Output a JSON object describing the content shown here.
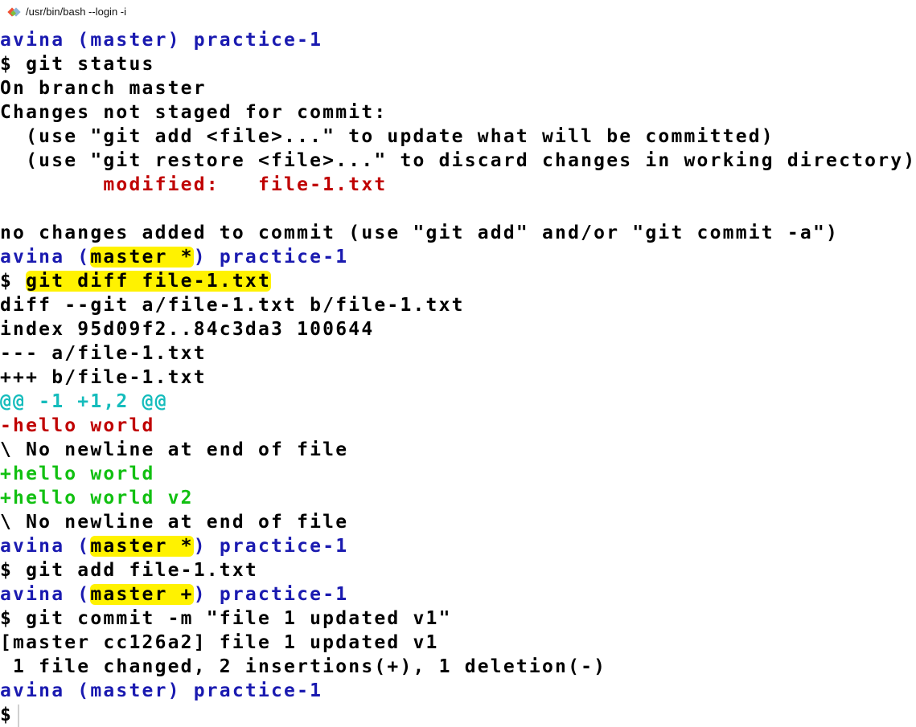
{
  "window": {
    "title": "/usr/bin/bash --login -i",
    "icon": "git-diamond-icon"
  },
  "colors": {
    "prompt": "#1a1ab0",
    "removed": "#c00000",
    "added": "#11c011",
    "hunk": "#15bcbc",
    "highlight": "#fff200"
  },
  "terminal": {
    "lines": [
      {
        "segments": [
          {
            "text": "avina (master) practice-1",
            "color": "blue"
          }
        ]
      },
      {
        "segments": [
          {
            "text": "$ git status",
            "color": "black"
          }
        ]
      },
      {
        "segments": [
          {
            "text": "On branch master",
            "color": "black"
          }
        ]
      },
      {
        "segments": [
          {
            "text": "Changes not staged for commit:",
            "color": "black"
          }
        ]
      },
      {
        "segments": [
          {
            "text": "  (use \"git add <file>...\" to update what will be committed)",
            "color": "black"
          }
        ]
      },
      {
        "segments": [
          {
            "text": "  (use \"git restore <file>...\" to discard changes in working directory)",
            "color": "black"
          }
        ]
      },
      {
        "segments": [
          {
            "text": "        modified:   file-1.txt",
            "color": "red"
          }
        ]
      },
      {
        "segments": [
          {
            "text": "",
            "color": "black"
          }
        ]
      },
      {
        "segments": [
          {
            "text": "no changes added to commit (use \"git add\" and/or \"git commit -a\")",
            "color": "black"
          }
        ]
      },
      {
        "segments": [
          {
            "text": "avina (",
            "color": "blue"
          },
          {
            "text": "master *",
            "color": "black",
            "highlight": true
          },
          {
            "text": ") practice-1",
            "color": "blue"
          }
        ]
      },
      {
        "segments": [
          {
            "text": "$ ",
            "color": "black"
          },
          {
            "text": "git diff file-1.txt",
            "color": "black",
            "highlight": true
          }
        ]
      },
      {
        "segments": [
          {
            "text": "diff --git a/file-1.txt b/file-1.txt",
            "color": "black"
          }
        ]
      },
      {
        "segments": [
          {
            "text": "index 95d09f2..84c3da3 100644",
            "color": "black"
          }
        ]
      },
      {
        "segments": [
          {
            "text": "--- a/file-1.txt",
            "color": "black"
          }
        ]
      },
      {
        "segments": [
          {
            "text": "+++ b/file-1.txt",
            "color": "black"
          }
        ]
      },
      {
        "segments": [
          {
            "text": "@@ -1 +1,2 @@",
            "color": "cyan"
          }
        ]
      },
      {
        "segments": [
          {
            "text": "-hello world",
            "color": "red"
          }
        ]
      },
      {
        "segments": [
          {
            "text": "\\ No newline at end of file",
            "color": "black"
          }
        ]
      },
      {
        "segments": [
          {
            "text": "+hello world",
            "color": "green"
          }
        ]
      },
      {
        "segments": [
          {
            "text": "+hello world v2",
            "color": "green"
          }
        ]
      },
      {
        "segments": [
          {
            "text": "\\ No newline at end of file",
            "color": "black"
          }
        ]
      },
      {
        "segments": [
          {
            "text": "avina (",
            "color": "blue"
          },
          {
            "text": "master *",
            "color": "black",
            "highlight": true
          },
          {
            "text": ") practice-1",
            "color": "blue"
          }
        ]
      },
      {
        "segments": [
          {
            "text": "$ git add file-1.txt",
            "color": "black"
          }
        ]
      },
      {
        "segments": [
          {
            "text": "avina (",
            "color": "blue"
          },
          {
            "text": "master +",
            "color": "black",
            "highlight": true
          },
          {
            "text": ") practice-1",
            "color": "blue"
          }
        ]
      },
      {
        "segments": [
          {
            "text": "$ git commit -m \"file 1 updated v1\"",
            "color": "black"
          }
        ]
      },
      {
        "segments": [
          {
            "text": "[master cc126a2] file 1 updated v1",
            "color": "black"
          }
        ]
      },
      {
        "segments": [
          {
            "text": " 1 file changed, 2 insertions(+), 1 deletion(-)",
            "color": "black"
          }
        ]
      },
      {
        "segments": [
          {
            "text": "avina (master) practice-1",
            "color": "blue"
          }
        ]
      },
      {
        "segments": [
          {
            "text": "$",
            "color": "black"
          }
        ],
        "cursor": true
      }
    ]
  }
}
